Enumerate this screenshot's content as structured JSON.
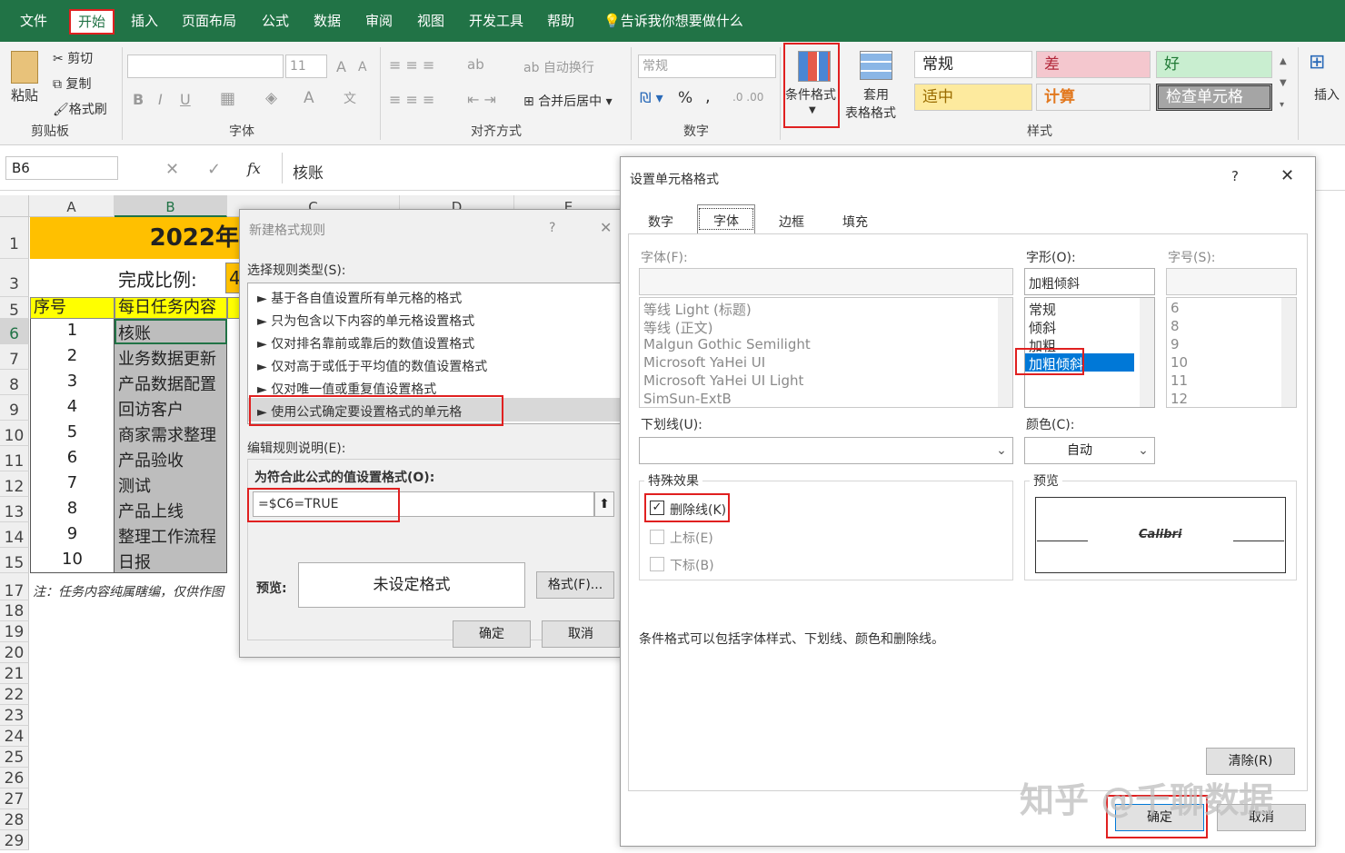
{
  "ribbon": {
    "tabs": [
      "文件",
      "开始",
      "插入",
      "页面布局",
      "公式",
      "数据",
      "审阅",
      "视图",
      "开发工具",
      "帮助",
      "告诉我你想要做什么"
    ],
    "clipboard": {
      "paste": "粘贴",
      "cut": "剪切",
      "copy": "复制",
      "format_painter": "格式刷",
      "group": "剪贴板"
    },
    "font": {
      "size": "11",
      "group": "字体",
      "bold": "B",
      "italic": "I",
      "underline": "U",
      "grow": "A",
      "shrink": "A"
    },
    "alignment": {
      "wrap": "自动换行",
      "merge": "合并后居中",
      "group": "对齐方式"
    },
    "number": {
      "format": "常规",
      "percent": "%",
      "comma": ",",
      "group": "数字"
    },
    "styles": {
      "conditional": "条件格式",
      "table_format_1": "套用",
      "table_format_2": "表格格式",
      "group": "样式",
      "normal": "常规",
      "bad": "差",
      "good": "好",
      "neutral": "适中",
      "calc": "计算",
      "check": "检查单元格"
    },
    "cells": {
      "insert": "插入"
    }
  },
  "formula_bar": {
    "name_box": "B6",
    "fx": "fx",
    "value": "核账",
    "cancel": "✕",
    "confirm": "✓"
  },
  "sheet": {
    "cols": [
      "A",
      "B",
      "C",
      "D",
      "E"
    ],
    "rows": [
      "1",
      "3",
      "5",
      "6",
      "7",
      "8",
      "9",
      "10",
      "11",
      "12",
      "13",
      "14",
      "15",
      "17",
      "18",
      "19",
      "20",
      "21",
      "22",
      "23",
      "24",
      "25",
      "26",
      "27",
      "28",
      "29"
    ],
    "title": "2022年",
    "ratio_label": "完成比例:",
    "ratio_value": "4",
    "hdr_no": "序号",
    "hdr_task": "每日任务内容",
    "tasks": [
      {
        "no": "1",
        "task": "核账"
      },
      {
        "no": "2",
        "task": "业务数据更新"
      },
      {
        "no": "3",
        "task": "产品数据配置"
      },
      {
        "no": "4",
        "task": "回访客户"
      },
      {
        "no": "5",
        "task": "商家需求整理"
      },
      {
        "no": "6",
        "task": "产品验收"
      },
      {
        "no": "7",
        "task": "测试"
      },
      {
        "no": "8",
        "task": "产品上线"
      },
      {
        "no": "9",
        "task": "整理工作流程"
      },
      {
        "no": "10",
        "task": "日报"
      }
    ],
    "note": "注：任务内容纯属瞎编，仅供作图"
  },
  "new_rule_dialog": {
    "title": "新建格式规则",
    "help": "?",
    "close": "✕",
    "select_type_label": "选择规则类型(S):",
    "rule_types": [
      "► 基于各自值设置所有单元格的格式",
      "► 只为包含以下内容的单元格设置格式",
      "► 仅对排名靠前或靠后的数值设置格式",
      "► 仅对高于或低于平均值的数值设置格式",
      "► 仅对唯一值或重复值设置格式",
      "► 使用公式确定要设置格式的单元格"
    ],
    "edit_desc_label": "编辑规则说明(E):",
    "formula_label": "为符合此公式的值设置格式(O):",
    "formula": "=$C6=TRUE",
    "preview_label": "预览:",
    "preview_text": "未设定格式",
    "format_button": "格式(F)...",
    "ok": "确定",
    "cancel": "取消"
  },
  "format_cells_dialog": {
    "title": "设置单元格格式",
    "help": "?",
    "close": "✕",
    "tabs": [
      "数字",
      "字体",
      "边框",
      "填充"
    ],
    "font_label": "字体(F):",
    "fonts": [
      "等线 Light (标题)",
      "等线 (正文)",
      "Malgun Gothic Semilight",
      "Microsoft YaHei UI",
      "Microsoft YaHei UI Light",
      "SimSun-ExtB"
    ],
    "style_label": "字形(O):",
    "style_value": "加粗倾斜",
    "styles": [
      "常规",
      "倾斜",
      "加粗",
      "加粗倾斜"
    ],
    "size_label": "字号(S):",
    "sizes": [
      "6",
      "8",
      "9",
      "10",
      "11",
      "12"
    ],
    "underline_label": "下划线(U):",
    "color_label": "颜色(C):",
    "color_value": "自动",
    "effects_label": "特殊效果",
    "strikethrough": "删除线(K)",
    "superscript": "上标(E)",
    "subscript": "下标(B)",
    "preview_label": "预览",
    "preview_text": "Calibri",
    "info": "条件格式可以包括字体样式、下划线、颜色和删除线。",
    "clear": "清除(R)",
    "ok": "确定",
    "cancel": "取消"
  },
  "watermark": "知乎 @千聊数据"
}
